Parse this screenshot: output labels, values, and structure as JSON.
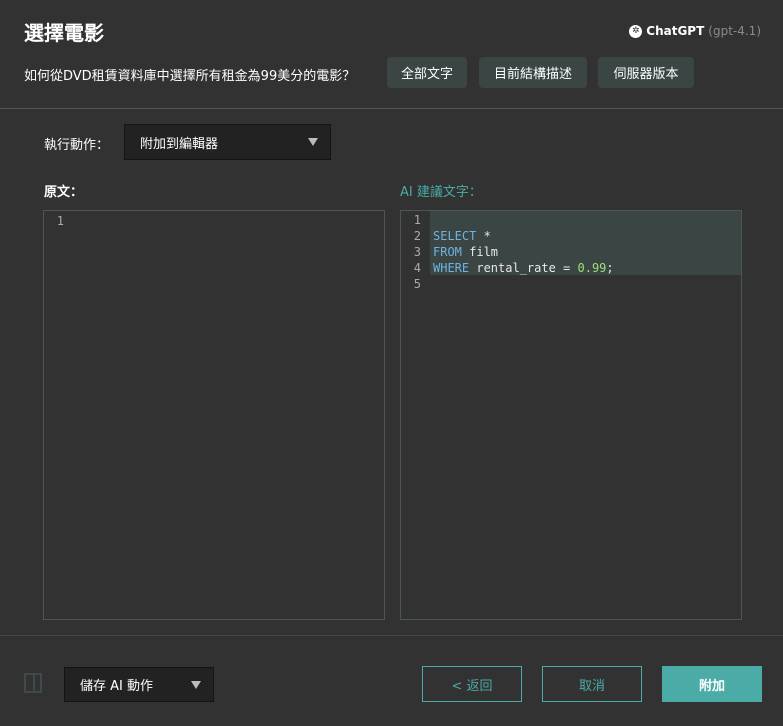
{
  "header": {
    "title": "選擇電影",
    "brand": "ChatGPT",
    "model": "(gpt-4.1)",
    "question": "如何從DVD租賃資料庫中選擇所有租金為99美分的電影？",
    "tabs": [
      "全部文字",
      "目前結構描述",
      "伺服器版本"
    ]
  },
  "action": {
    "label": "執行動作：",
    "value": "附加到編輯器"
  },
  "original": {
    "label": "原文：",
    "lines": [
      "1"
    ]
  },
  "suggestion": {
    "label": "AI 建議文字：",
    "line_numbers": [
      "1",
      "2",
      "3",
      "4",
      "5"
    ],
    "code": {
      "l2_kw": "SELECT",
      "l2_rest": " *",
      "l3_kw": "FROM",
      "l3_rest": " film",
      "l4_kw": "WHERE",
      "l4_rest": " rental_rate = ",
      "l4_num": "0.99",
      "l4_end": ";"
    }
  },
  "footer": {
    "save_action": "儲存 AI 動作",
    "back": "< 返回",
    "cancel": "取消",
    "attach": "附加"
  },
  "colors": {
    "accent": "#4aaba7",
    "keyword": "#6fb3e0",
    "number": "#9be07a"
  }
}
